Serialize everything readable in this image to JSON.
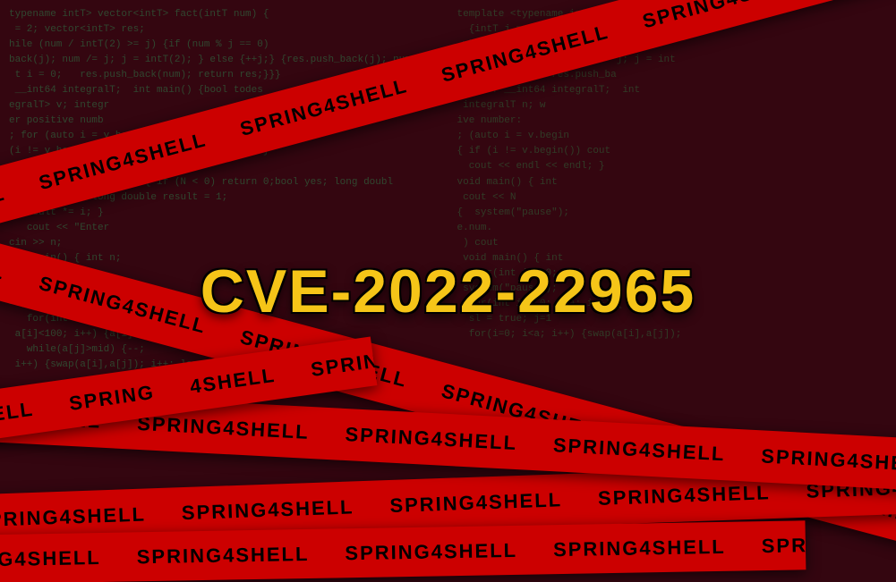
{
  "title": "CVE-2022-22965",
  "subtitle": "Spring4Shell",
  "code_left": "typename intT> vector<intT> fact(intT num) {\n = 2; vector<intT> res;\nhile (num / intT(2) >= j) {if (num % j == 0)\nback(j); num /= j; j = intT(2); } else {++j;} {res.push_back(j); num /= j; j = int\n t i = 0;   res.push_back(num); return res;}}}\n __int64 integralT;  int main() {bool todes\negralT> v; integr\ner positive numb\n; for (auto i = v.begin(), I=v.end(), l=y\n(i != v.begin()) cout << \", \"; cout << *i; }\n< endl << endl; } return 0; }\nong double fact(int N) { if (N < 0) return 0;bool yes; long doubl\n 0) return 1; long double result = 1;\n  result *= i; }\n   cout << \"Enter\ncin >> n;\nint main() { int n;\nsystem(\"pause\n int size_num)\n=0; i<si\n   for(int i = 0; i<100\n a[i]<100; i++) {a[i] = i;}\n   while(a[j]>mid) {--;\n i++) {swap(a[i],a[j]); i++; long m",
  "code_right": "template <typename intT> vector<int\n  {intT j = 2; vector<intT> res;\n while (num / intT(2) >= 1)\n {res.push_back(j); num /= j; j = int\n   int i = 0;   res.push_ba\ntypedef __int64 integralT;  int\n integralT n; w\nive number:\n; (auto i = v.begin\n{ if (i != v.begin()) cout\n  cout << endl << endl; }\nvoid main() { int\n cout << N\n{  system(\"pause\");\ne.num.\n ) cout\n void main() { int\n   for(int i = 0; i<N\n system(\"pause\");\n  for(int i = 0; i<a; i++) {\n  sl = true; j=1\n  for(i=0; i<a; i++) {swap(a[i],a[j]);",
  "tapes": [
    {
      "id": "tape-1",
      "labels": [
        "SPRING4SHELL",
        "SPRING4SHELL",
        "SPRING4SHELL",
        "SPRING4SHELL",
        "SPRING4SHELL"
      ]
    },
    {
      "id": "tape-2",
      "labels": [
        "SPRING4SHELL",
        "SPRING4SHELL",
        "SPRING4SHELL",
        "SPRING4SHELL",
        "SPRING4SHELL"
      ]
    },
    {
      "id": "tape-3",
      "labels": [
        "SPRING4SHELL",
        "SPRING4SHELL",
        "SPRING4SHELL",
        "SPRING4SHELL"
      ]
    },
    {
      "id": "tape-4",
      "labels": [
        "SPRING4SHELL",
        "SPRING4SHELL",
        "SPRING4SHELL",
        "SPRING4SHELL"
      ]
    },
    {
      "id": "tape-5",
      "labels": [
        "4SHELL",
        "SPRING",
        "4SHELL"
      ]
    },
    {
      "id": "tape-6",
      "labels": [
        "SPRING4SHELL",
        "SPRING4SHELL",
        "SPRING4SHELL",
        "SPRING4SHELL"
      ]
    }
  ],
  "colors": {
    "tape": "#cc0000",
    "tape_text": "#000000",
    "cve_text": "#f5c518",
    "code": "rgba(0,200,120,0.55)",
    "bg": "#0a0a1a"
  }
}
